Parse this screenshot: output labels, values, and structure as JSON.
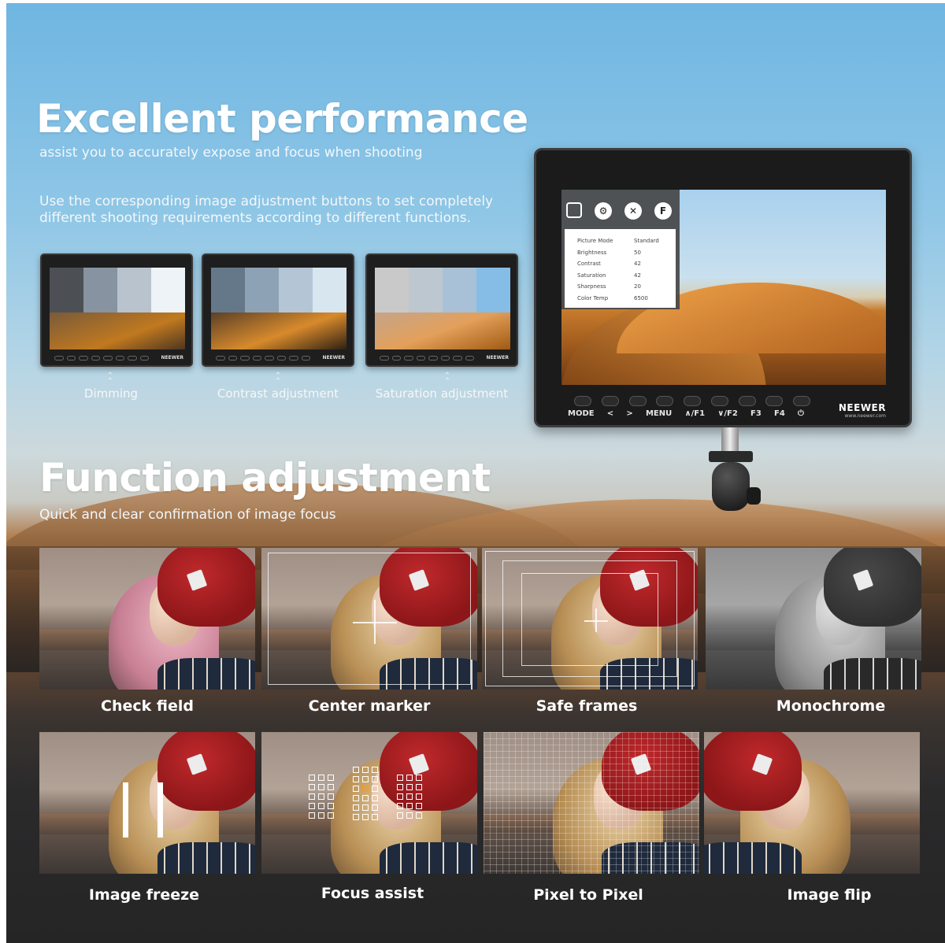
{
  "perf": {
    "title": "Excellent performance",
    "subtitle": "assist you to accurately expose and focus when shooting",
    "paragraph": "Use the corresponding image adjustment buttons to set completely different shooting requirements according to different functions."
  },
  "modes": [
    {
      "label": "Dimming"
    },
    {
      "label": "Contrast adjustment"
    },
    {
      "label": "Saturation adjustment"
    }
  ],
  "chevron": "⌃\n⌃",
  "monitor": {
    "brand": "NEEWER",
    "url": "www.neewer.com",
    "menu_icons": [
      "□",
      "⚙",
      "✕",
      "F"
    ],
    "menu": [
      {
        "key": "Picture Mode",
        "value": "Standard"
      },
      {
        "key": "Brightness",
        "value": "50"
      },
      {
        "key": "Contrast",
        "value": "42"
      },
      {
        "key": "Saturation",
        "value": "42"
      },
      {
        "key": "Sharpness",
        "value": "20"
      },
      {
        "key": "Color Temp",
        "value": "6500"
      }
    ],
    "buttons": [
      "MODE",
      "<",
      ">",
      "MENU",
      "∧/F1",
      "∨/F2",
      "F3",
      "F4",
      "⏻"
    ],
    "mini_brand": "NEEWER"
  },
  "func": {
    "title": "Function adjustment",
    "subtitle": "Quick and clear confirmation of image focus"
  },
  "tiles": [
    {
      "label": "Check field"
    },
    {
      "label": "Center marker"
    },
    {
      "label": "Safe frames"
    },
    {
      "label": "Monochrome"
    },
    {
      "label": "Image freeze"
    },
    {
      "label": "Focus assist"
    },
    {
      "label": "Pixel to Pixel"
    },
    {
      "label": "Image flip"
    }
  ],
  "colors": {
    "sky": "#6fb6e2",
    "sand": "#c48d58",
    "dark": "#252526",
    "focus_highlight": "#ff9a1a",
    "hat": "#c0292c"
  }
}
